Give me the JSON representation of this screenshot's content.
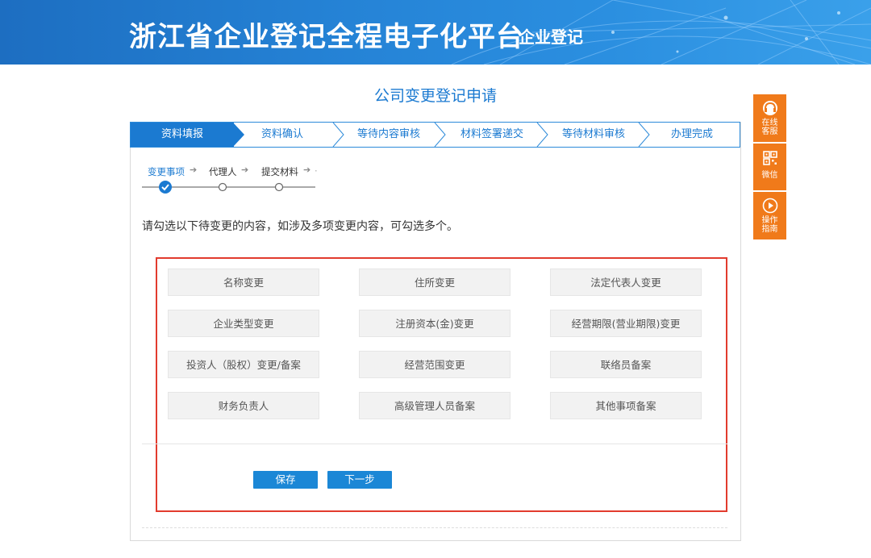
{
  "banner": {
    "title": "浙江省企业登记全程电子化平台",
    "subtitle": "– 企业登记"
  },
  "page_title": "公司变更登记申请",
  "steps": [
    {
      "label": "资料填报",
      "active": true
    },
    {
      "label": "资料确认",
      "active": false
    },
    {
      "label": "等待内容审核",
      "active": false
    },
    {
      "label": "材料签署递交",
      "active": false
    },
    {
      "label": "等待材料审核",
      "active": false
    },
    {
      "label": "办理完成",
      "active": false
    }
  ],
  "substeps": [
    {
      "label": "变更事项",
      "active": true
    },
    {
      "label": "代理人",
      "active": false
    },
    {
      "label": "提交材料",
      "active": false
    }
  ],
  "instruction": "请勾选以下待变更的内容，如涉及多项变更内容，可勾选多个。",
  "options": [
    "名称变更",
    "住所变更",
    "法定代表人变更",
    "企业类型变更",
    "注册资本(金)变更",
    "经营期限(营业期限)变更",
    "投资人（股权）变更/备案",
    "经营范围变更",
    "联络员备案",
    "财务负责人",
    "高级管理人员备案",
    "其他事项备案"
  ],
  "buttons": {
    "save": "保存",
    "next": "下一步"
  },
  "sidebar": {
    "service": [
      "在线",
      "客服"
    ],
    "wechat": [
      "微信"
    ],
    "guide": [
      "操作",
      "指南"
    ]
  },
  "colors": {
    "brand_blue": "#1b7ad1",
    "highlight_red": "#e23b2e",
    "side_orange": "#f07a1a"
  }
}
